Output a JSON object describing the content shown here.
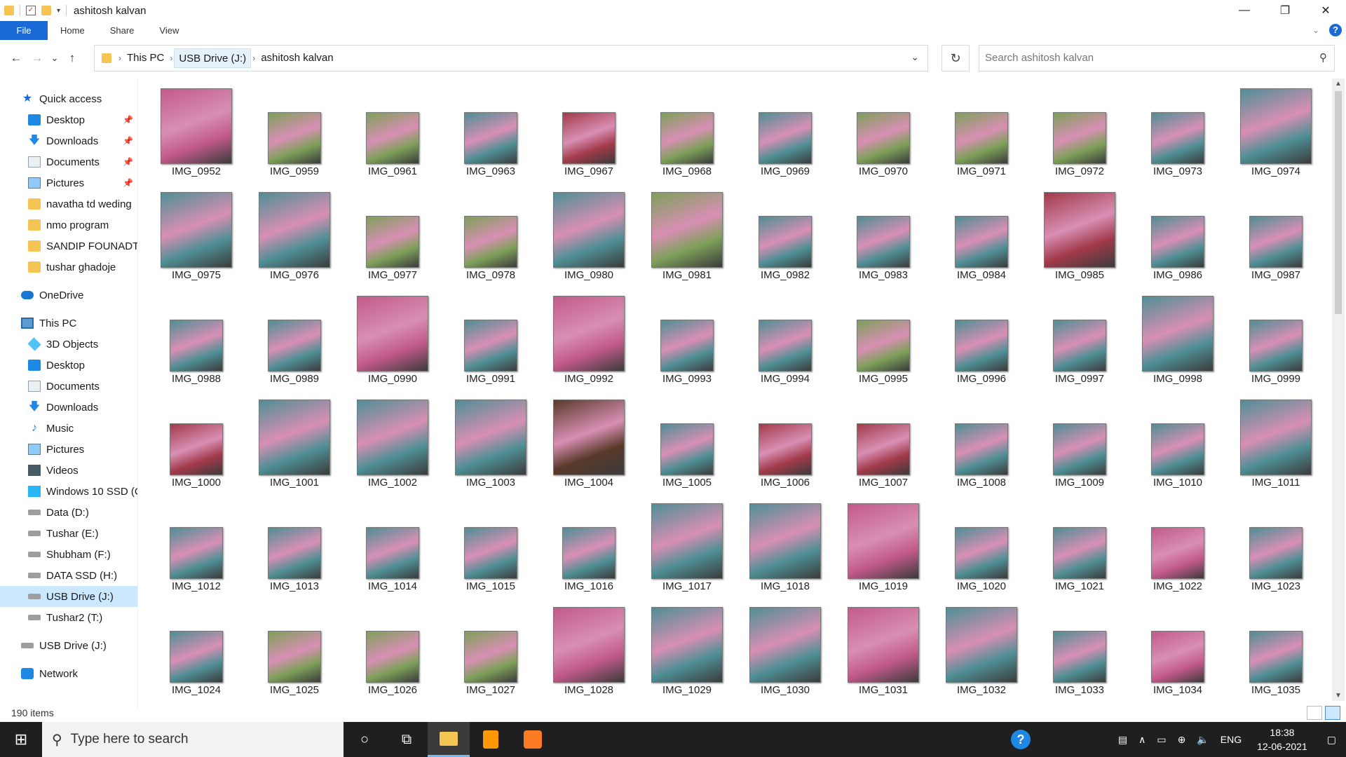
{
  "window": {
    "title": "ashitosh kalvan",
    "controls": {
      "minimize": "—",
      "maximize": "❐",
      "close": "✕"
    }
  },
  "ribbon": {
    "tabs": [
      "File",
      "Home",
      "Share",
      "View"
    ],
    "help": "?"
  },
  "nav": {
    "back": "←",
    "forward": "→",
    "recent": "⌄",
    "up": "↑",
    "breadcrumbs": [
      "This PC",
      "USB Drive (J:)",
      "ashitosh kalvan"
    ],
    "refresh": "↻",
    "search_placeholder": "Search ashitosh kalvan"
  },
  "sidebar": {
    "quick_access": {
      "label": "Quick access",
      "items": [
        {
          "label": "Desktop",
          "icon": "desktop-icon",
          "pinned": true
        },
        {
          "label": "Downloads",
          "icon": "download-icon",
          "pinned": true
        },
        {
          "label": "Documents",
          "icon": "documents-icon",
          "pinned": true
        },
        {
          "label": "Pictures",
          "icon": "pictures-icon",
          "pinned": true
        },
        {
          "label": "navatha td weding",
          "icon": "folder-icon",
          "pinned": false
        },
        {
          "label": "nmo program",
          "icon": "folder-icon",
          "pinned": false
        },
        {
          "label": "SANDIP FOUNADTIO",
          "icon": "folder-icon",
          "pinned": false
        },
        {
          "label": "tushar ghadoje",
          "icon": "folder-icon",
          "pinned": false
        }
      ]
    },
    "onedrive": "OneDrive",
    "this_pc": {
      "label": "This PC",
      "items": [
        {
          "label": "3D Objects",
          "icon": "cube-icon"
        },
        {
          "label": "Desktop",
          "icon": "desktop-icon"
        },
        {
          "label": "Documents",
          "icon": "documents-icon"
        },
        {
          "label": "Downloads",
          "icon": "download-icon"
        },
        {
          "label": "Music",
          "icon": "music-icon"
        },
        {
          "label": "Pictures",
          "icon": "pictures-icon"
        },
        {
          "label": "Videos",
          "icon": "videos-icon"
        },
        {
          "label": "Windows 10 SSD (C",
          "icon": "windows-drive-icon"
        },
        {
          "label": "Data (D:)",
          "icon": "drive-icon"
        },
        {
          "label": "Tushar (E:)",
          "icon": "drive-icon"
        },
        {
          "label": "Shubham (F:)",
          "icon": "drive-icon"
        },
        {
          "label": "DATA SSD (H:)",
          "icon": "drive-icon"
        },
        {
          "label": "USB Drive (J:)",
          "icon": "drive-icon",
          "selected": true
        },
        {
          "label": "Tushar2 (T:)",
          "icon": "drive-icon"
        }
      ]
    },
    "usb_drive": "USB Drive (J:)",
    "network": "Network"
  },
  "files": [
    {
      "name": "IMG_0952",
      "orient": "port",
      "tone": "pink"
    },
    {
      "name": "IMG_0959",
      "orient": "land",
      "tone": "green"
    },
    {
      "name": "IMG_0961",
      "orient": "land",
      "tone": "green"
    },
    {
      "name": "IMG_0963",
      "orient": "land",
      "tone": "teal"
    },
    {
      "name": "IMG_0967",
      "orient": "land",
      "tone": "red"
    },
    {
      "name": "IMG_0968",
      "orient": "land",
      "tone": "green"
    },
    {
      "name": "IMG_0969",
      "orient": "land",
      "tone": "teal"
    },
    {
      "name": "IMG_0970",
      "orient": "land",
      "tone": "green"
    },
    {
      "name": "IMG_0971",
      "orient": "land",
      "tone": "green"
    },
    {
      "name": "IMG_0972",
      "orient": "land",
      "tone": "green"
    },
    {
      "name": "IMG_0973",
      "orient": "land",
      "tone": "teal"
    },
    {
      "name": "IMG_0974",
      "orient": "port",
      "tone": "teal"
    },
    {
      "name": "IMG_0975",
      "orient": "port",
      "tone": "teal"
    },
    {
      "name": "IMG_0976",
      "orient": "port",
      "tone": "teal"
    },
    {
      "name": "IMG_0977",
      "orient": "land",
      "tone": "green"
    },
    {
      "name": "IMG_0978",
      "orient": "land",
      "tone": "green"
    },
    {
      "name": "IMG_0980",
      "orient": "port",
      "tone": "teal"
    },
    {
      "name": "IMG_0981",
      "orient": "port",
      "tone": "green"
    },
    {
      "name": "IMG_0982",
      "orient": "land",
      "tone": "teal"
    },
    {
      "name": "IMG_0983",
      "orient": "land",
      "tone": "teal"
    },
    {
      "name": "IMG_0984",
      "orient": "land",
      "tone": "teal"
    },
    {
      "name": "IMG_0985",
      "orient": "port",
      "tone": "red"
    },
    {
      "name": "IMG_0986",
      "orient": "land",
      "tone": "teal"
    },
    {
      "name": "IMG_0987",
      "orient": "land",
      "tone": "teal"
    },
    {
      "name": "IMG_0988",
      "orient": "land",
      "tone": "teal"
    },
    {
      "name": "IMG_0989",
      "orient": "land",
      "tone": "teal"
    },
    {
      "name": "IMG_0990",
      "orient": "port",
      "tone": "pink"
    },
    {
      "name": "IMG_0991",
      "orient": "land",
      "tone": "teal"
    },
    {
      "name": "IMG_0992",
      "orient": "port",
      "tone": "pink"
    },
    {
      "name": "IMG_0993",
      "orient": "land",
      "tone": "teal"
    },
    {
      "name": "IMG_0994",
      "orient": "land",
      "tone": "teal"
    },
    {
      "name": "IMG_0995",
      "orient": "land",
      "tone": "green"
    },
    {
      "name": "IMG_0996",
      "orient": "land",
      "tone": "teal"
    },
    {
      "name": "IMG_0997",
      "orient": "land",
      "tone": "teal"
    },
    {
      "name": "IMG_0998",
      "orient": "port",
      "tone": "teal"
    },
    {
      "name": "IMG_0999",
      "orient": "land",
      "tone": "teal"
    },
    {
      "name": "IMG_1000",
      "orient": "land",
      "tone": "red"
    },
    {
      "name": "IMG_1001",
      "orient": "port",
      "tone": "teal"
    },
    {
      "name": "IMG_1002",
      "orient": "port",
      "tone": "teal"
    },
    {
      "name": "IMG_1003",
      "orient": "port",
      "tone": "teal"
    },
    {
      "name": "IMG_1004",
      "orient": "port",
      "tone": "dark"
    },
    {
      "name": "IMG_1005",
      "orient": "land",
      "tone": "teal"
    },
    {
      "name": "IMG_1006",
      "orient": "land",
      "tone": "red"
    },
    {
      "name": "IMG_1007",
      "orient": "land",
      "tone": "red"
    },
    {
      "name": "IMG_1008",
      "orient": "land",
      "tone": "teal"
    },
    {
      "name": "IMG_1009",
      "orient": "land",
      "tone": "teal"
    },
    {
      "name": "IMG_1010",
      "orient": "land",
      "tone": "teal"
    },
    {
      "name": "IMG_1011",
      "orient": "port",
      "tone": "teal"
    },
    {
      "name": "IMG_1012",
      "orient": "land",
      "tone": "teal"
    },
    {
      "name": "IMG_1013",
      "orient": "land",
      "tone": "teal"
    },
    {
      "name": "IMG_1014",
      "orient": "land",
      "tone": "teal"
    },
    {
      "name": "IMG_1015",
      "orient": "land",
      "tone": "teal"
    },
    {
      "name": "IMG_1016",
      "orient": "land",
      "tone": "teal"
    },
    {
      "name": "IMG_1017",
      "orient": "port",
      "tone": "teal"
    },
    {
      "name": "IMG_1018",
      "orient": "port",
      "tone": "teal"
    },
    {
      "name": "IMG_1019",
      "orient": "port",
      "tone": "pink"
    },
    {
      "name": "IMG_1020",
      "orient": "land",
      "tone": "teal"
    },
    {
      "name": "IMG_1021",
      "orient": "land",
      "tone": "teal"
    },
    {
      "name": "IMG_1022",
      "orient": "land",
      "tone": "pink"
    },
    {
      "name": "IMG_1023",
      "orient": "land",
      "tone": "teal"
    },
    {
      "name": "IMG_1024",
      "orient": "land",
      "tone": "teal"
    },
    {
      "name": "IMG_1025",
      "orient": "land",
      "tone": "green"
    },
    {
      "name": "IMG_1026",
      "orient": "land",
      "tone": "green"
    },
    {
      "name": "IMG_1027",
      "orient": "land",
      "tone": "green"
    },
    {
      "name": "IMG_1028",
      "orient": "port",
      "tone": "pink"
    },
    {
      "name": "IMG_1029",
      "orient": "port",
      "tone": "teal"
    },
    {
      "name": "IMG_1030",
      "orient": "port",
      "tone": "teal"
    },
    {
      "name": "IMG_1031",
      "orient": "port",
      "tone": "pink"
    },
    {
      "name": "IMG_1032",
      "orient": "port",
      "tone": "teal"
    },
    {
      "name": "IMG_1033",
      "orient": "land",
      "tone": "teal"
    },
    {
      "name": "IMG_1034",
      "orient": "land",
      "tone": "pink"
    },
    {
      "name": "IMG_1035",
      "orient": "land",
      "tone": "teal"
    }
  ],
  "tones": {
    "pink": "#c25a8a",
    "green": "#7ea05a",
    "teal": "#4f8f95",
    "red": "#a23a4a",
    "dark": "#5a3a2a"
  },
  "status": {
    "items": "190 items"
  },
  "taskbar": {
    "search_placeholder": "Type here to search",
    "lang": "ENG",
    "time": "18:38",
    "date": "12-06-2021"
  }
}
